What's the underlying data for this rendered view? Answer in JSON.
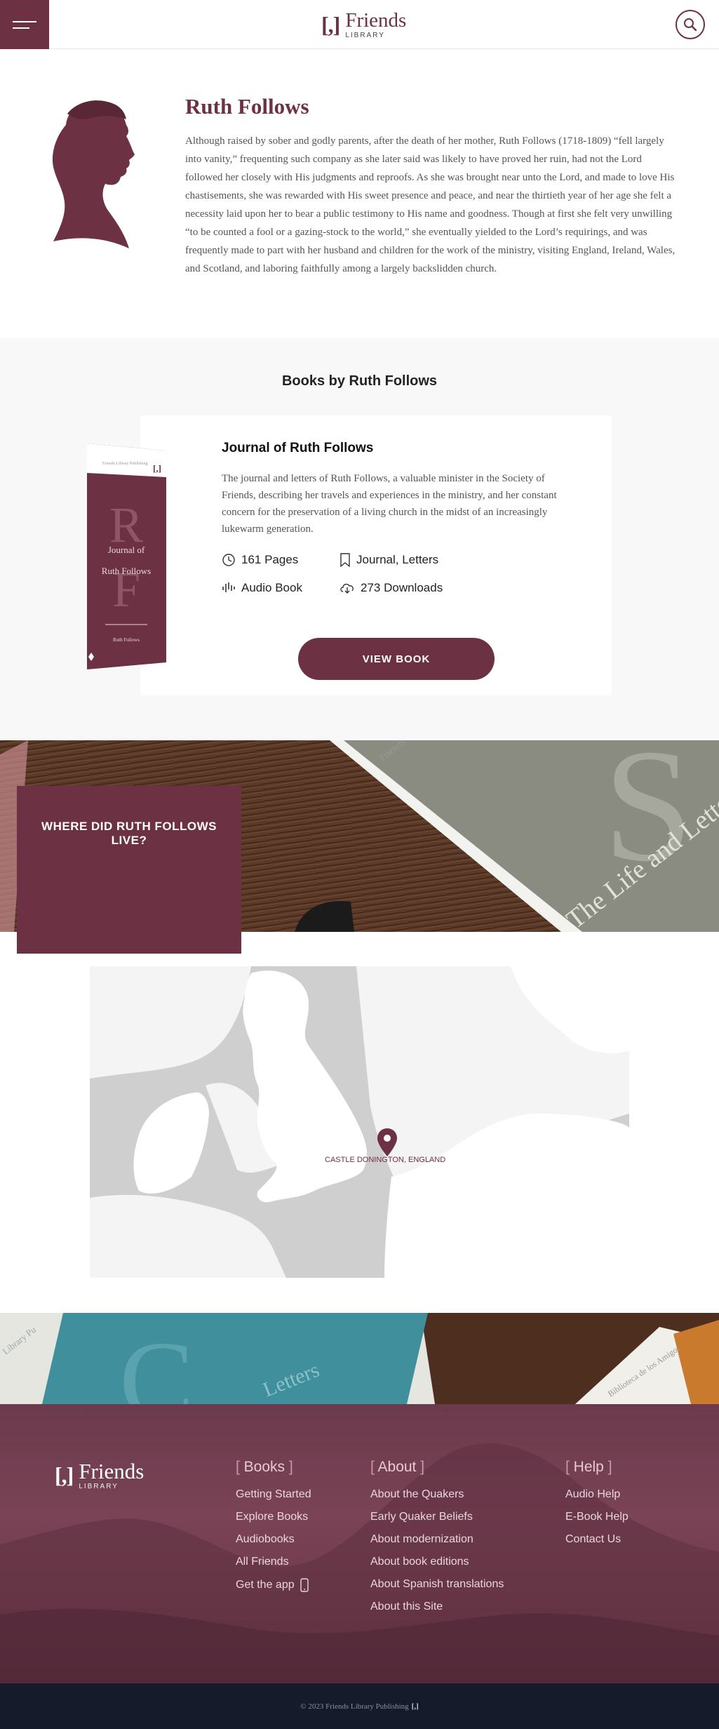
{
  "header": {
    "logo_mark": "[,]",
    "logo_name": "Friends",
    "logo_sub": "LIBRARY"
  },
  "author": {
    "name": "Ruth Follows",
    "bio": "Although raised by sober and godly parents, after the death of her mother, Ruth Follows (1718-1809) “fell largely into vanity,” frequenting such company as she later said was likely to have proved her ruin, had not the Lord followed her closely with His judgments and reproofs. As she was brought near unto the Lord, and made to love His chastisements, she was rewarded with His sweet presence and peace, and near the thirtieth year of her age she felt a necessity laid upon her to bear a public testimony to His name and goodness. Though at first she felt very unwilling “to be counted a fool or a gazing-stock to the world,” she eventually yielded to the Lord’s requirings, and was frequently made to part with her husband and children for the work of the ministry, visiting England, Ireland, Wales, and Scotland, and laboring faithfully among a largely backslidden church."
  },
  "books": {
    "heading": "Books by Ruth Follows",
    "items": [
      {
        "title": "Journal of Ruth Follows",
        "description": "The journal and letters of Ruth Follows, a valuable minister in the Society of Friends, describing her travels and experiences in the ministry, and her constant concern for the preservation of a living church in the midst of an increasingly lukewarm generation.",
        "pages": "161 Pages",
        "tags": "Journal, Letters",
        "audio": "Audio Book",
        "downloads": "273 Downloads",
        "button": "VIEW BOOK",
        "cover": {
          "publisher": "Friends Library Publishing",
          "mark": "[,]",
          "initial_1": "R",
          "initial_2": "F",
          "title_line_1": "Journal of",
          "title_line_2": "Ruth Follows",
          "author": "Ruth Follows",
          "color": "#6c3142"
        }
      }
    ]
  },
  "where": {
    "heading": "WHERE DID RUTH FOLLOWS LIVE?",
    "background_book_text": "The Life and Letters of Samuel Fo",
    "background_book_spine": "Friends"
  },
  "map": {
    "location_label": "CASTLE DONINGTON, ENGLAND",
    "marker_color": "#6c3142"
  },
  "banner2": {
    "book_text": "Letters",
    "spine_left": "Library Pu",
    "spine_right": "Biblioteca de los Amigos"
  },
  "footer": {
    "logo_mark": "[,]",
    "logo_name": "Friends",
    "logo_sub": "LIBRARY",
    "columns": [
      {
        "title": "Books",
        "links": [
          "Getting Started",
          "Explore Books",
          "Audiobooks",
          "All Friends",
          "Get the app"
        ]
      },
      {
        "title": "About",
        "links": [
          "About the Quakers",
          "Early Quaker Beliefs",
          "About modernization",
          "About book editions",
          "About Spanish translations",
          "About this Site"
        ]
      },
      {
        "title": "Help",
        "links": [
          "Audio Help",
          "E-Book Help",
          "Contact Us"
        ]
      }
    ],
    "copyright": "© 2023 Friends Library Publishing",
    "copyright_mark": "[,]"
  },
  "colors": {
    "brand": "#6c3142",
    "footer_bottom": "#161b2b"
  }
}
